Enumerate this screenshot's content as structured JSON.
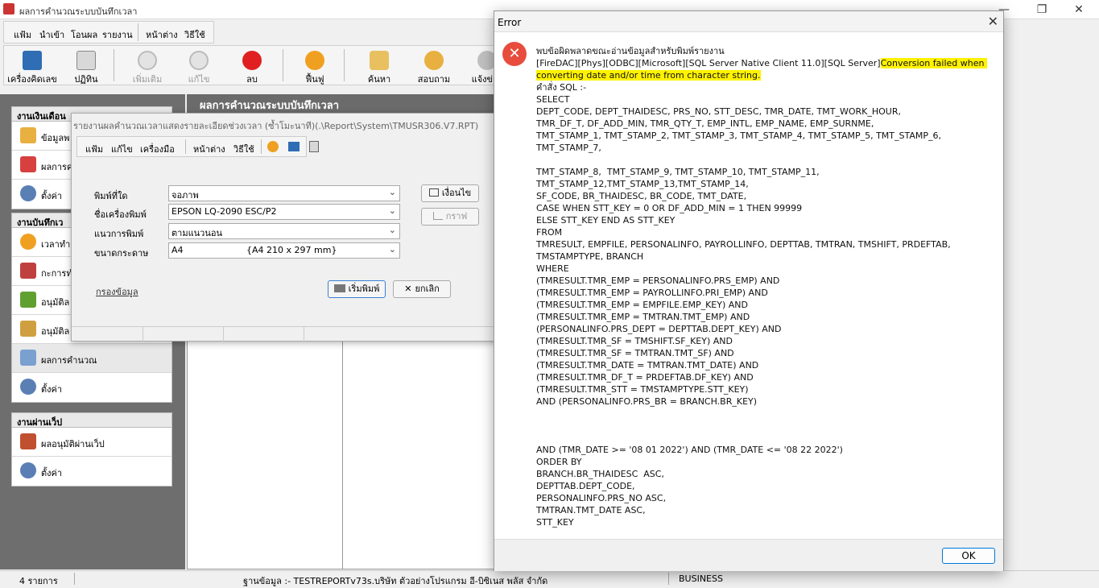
{
  "main": {
    "title": "ผลการคำนวณระบบบันทึกเวลา",
    "menus": [
      "แฟ้ม",
      "นำเข้า",
      "โอนผล",
      "รายงาน",
      "หน้าต่าง",
      "วิธีใช้"
    ],
    "toolbar": [
      "เครื่องคิดเลข",
      "ปฏิทิน",
      "เพิ่มเติม",
      "แก้ไข",
      "ลบ",
      "ฟื้นฟู",
      "ค้นหา",
      "สอบถาม",
      "แจ้งข่าว"
    ],
    "content_header": "ผลการคำนวณระบบบันทึกเวลา"
  },
  "nav": {
    "groups": [
      {
        "title": "งานเงินเดือน",
        "items": [
          "ข้อมูลพ",
          "ผลการค",
          "ตั้งค่า"
        ]
      },
      {
        "title": "งานบันทึกเว",
        "items": [
          "เวลาทำง",
          "กะการทำ",
          "อนุมัติล",
          "อนุมัติล",
          "ผลการคำนวณ",
          "ตั้งค่า"
        ]
      },
      {
        "title": "งานผ่านเว็ป",
        "items": [
          "ผลอนุมัติผ่านเว็ป",
          "ตั้งค่า"
        ]
      }
    ]
  },
  "status": {
    "count": "4 รายการ",
    "db": "ฐานข้อมูล :- TESTREPORTv73s.บริษัท ตัวอย่างโปรแกรม อี-บิซิเนส พลัส จำกัด",
    "mode": "BUSINESS"
  },
  "print_dialog": {
    "title": "รายงานผลคำนวณเวลาแสดงรายละเอียดช่วงเวลา (ซ้ำโมะนาที)(.\\Report\\System\\TMUSR306.V7.RPT)",
    "menus": [
      "แฟ้ม",
      "แก้ไข",
      "เครื่องมือ",
      "หน้าต่าง",
      "วิธีใช้"
    ],
    "fields": [
      {
        "label": "พิมพ์ที่ใด",
        "value": "จอภาพ"
      },
      {
        "label": "ชื่อเครื่องพิมพ์",
        "value": "EPSON LQ-2090 ESC/P2"
      },
      {
        "label": "แนวการพิมพ์",
        "value": "ตามแนวนอน"
      },
      {
        "label": "ขนาดกระดาษ",
        "value": "A4",
        "extra": "{A4 210 x 297 mm}"
      }
    ],
    "condition_btn": "เงื่อนไข",
    "graph_btn": "กราฟ",
    "print_btn": "เริ่มพิมพ์",
    "cancel_btn": "ยกเลิก",
    "filter_link": "กรองข้อมูล"
  },
  "error": {
    "title": "Error",
    "line1": "พบข้อผิดพลาดขณะอ่านข้อมูลสำหรับพิมพ์รายงาน",
    "line2_prefix": "[FireDAC][Phys][ODBC][Microsoft][SQL Server Native Client 11.0][SQL Server]",
    "line2_highlight": "Conversion failed when converting date and/or time from character string.",
    "sql_label": "คำสั่ง SQL :-",
    "sql": "SELECT\nDEPT_CODE, DEPT_THAIDESC, PRS_NO, STT_DESC, TMR_DATE, TMT_WORK_HOUR,\nTMR_DF_T, DF_ADD_MIN, TMR_QTY_T, EMP_INTL, EMP_NAME, EMP_SURNME,\nTMT_STAMP_1, TMT_STAMP_2, TMT_STAMP_3, TMT_STAMP_4, TMT_STAMP_5, TMT_STAMP_6, TMT_STAMP_7,\n\nTMT_STAMP_8,  TMT_STAMP_9, TMT_STAMP_10, TMT_STAMP_11,\nTMT_STAMP_12,TMT_STAMP_13,TMT_STAMP_14,\nSF_CODE, BR_THAIDESC, BR_CODE, TMT_DATE,\nCASE WHEN STT_KEY = 0 OR DF_ADD_MIN = 1 THEN 99999\nELSE STT_KEY END AS STT_KEY\nFROM\nTMRESULT, EMPFILE, PERSONALINFO, PAYROLLINFO, DEPTTAB, TMTRAN, TMSHIFT, PRDEFTAB,\nTMSTAMPTYPE, BRANCH\nWHERE\n(TMRESULT.TMR_EMP = PERSONALINFO.PRS_EMP) AND\n(TMRESULT.TMR_EMP = PAYROLLINFO.PRI_EMP) AND\n(TMRESULT.TMR_EMP = EMPFILE.EMP_KEY) AND\n(TMRESULT.TMR_EMP = TMTRAN.TMT_EMP) AND\n(PERSONALINFO.PRS_DEPT = DEPTTAB.DEPT_KEY) AND\n(TMRESULT.TMR_SF = TMSHIFT.SF_KEY) AND\n(TMRESULT.TMR_SF = TMTRAN.TMT_SF) AND\n(TMRESULT.TMR_DATE = TMTRAN.TMT_DATE) AND\n(TMRESULT.TMR_DF_T = PRDEFTAB.DF_KEY) AND\n(TMRESULT.TMR_STT = TMSTAMPTYPE.STT_KEY)\nAND (PERSONALINFO.PRS_BR = BRANCH.BR_KEY)\n\n\n\nAND (TMR_DATE >= '08 01 2022') AND (TMR_DATE <= '08 22 2022')\nORDER BY\nBRANCH.BR_THAIDESC  ASC,\nDEPTTAB.DEPT_CODE,\nPERSONALINFO.PRS_NO ASC,\nTMTRAN.TMT_DATE ASC,\nSTT_KEY",
    "ok": "OK"
  }
}
